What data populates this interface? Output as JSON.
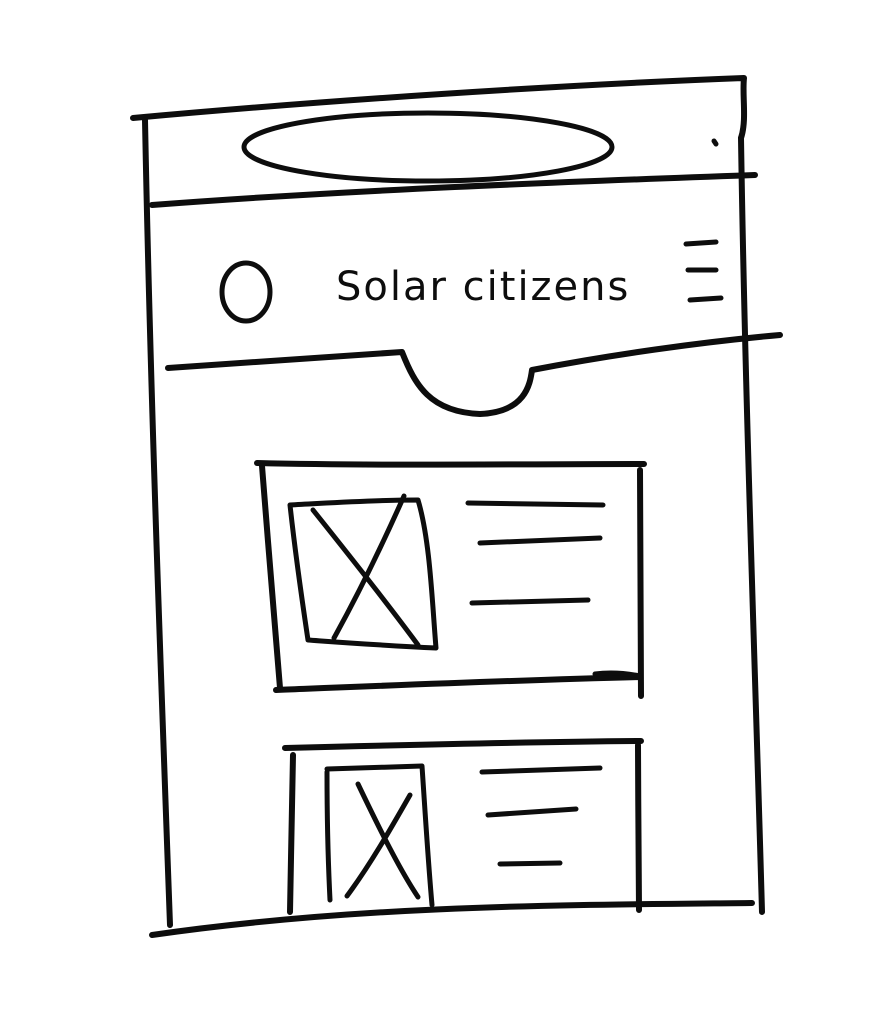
{
  "header": {
    "brand_name": "Solar citizens"
  },
  "icons": {
    "logo": "circle-logo-icon",
    "menu": "hamburger-menu-icon",
    "pull_tab": "pull-down-tab-icon"
  },
  "cards": [
    {
      "image": "image-placeholder",
      "text_lines": 3
    },
    {
      "image": "image-placeholder",
      "text_lines": 3
    }
  ]
}
